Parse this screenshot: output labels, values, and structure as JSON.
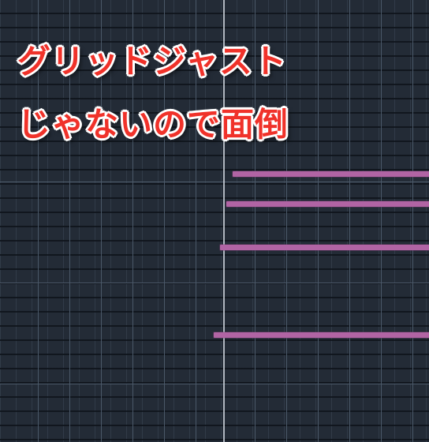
{
  "overlay": {
    "line1": "グリッドジャスト",
    "line2": "じゃないので面倒"
  },
  "piano_roll": {
    "note_color": "#b164a4",
    "grid_color": "#4a5868",
    "background_color": "#232b36",
    "playhead_color": "#c9d0d8",
    "notes_count_visible": 4
  }
}
